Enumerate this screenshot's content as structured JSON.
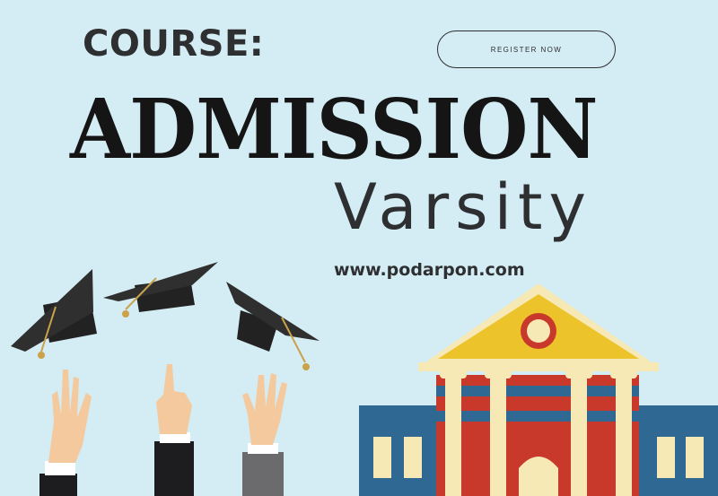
{
  "header": {
    "label": "COURSE:",
    "register_label": "REGISTER NOW"
  },
  "hero": {
    "title": "ADMISSION",
    "subtitle": "Varsity",
    "website": "www.podarpon.com"
  },
  "colors": {
    "background": "#d4ecf3",
    "text_dark": "#2e2f31",
    "building_red": "#c9392b",
    "building_blue": "#2f6892",
    "building_yellow": "#ecc32b",
    "column_cream": "#f6e9b6",
    "cap_black": "#2a2a2a",
    "tassel_gold": "#c9a24a"
  },
  "illustration": {
    "icons": [
      "graduation-cap-icon",
      "raised-hand-icon",
      "university-building-icon"
    ]
  }
}
